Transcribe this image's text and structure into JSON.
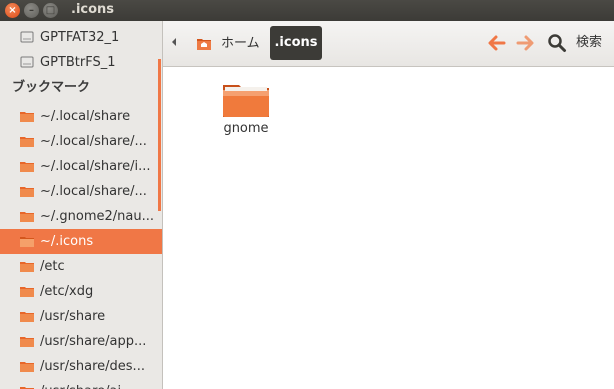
{
  "window": {
    "title": ".icons"
  },
  "sidebar": {
    "devices": [
      "GPTFAT32_1",
      "GPTBtrFS_1"
    ],
    "bookmarks_header": "ブックマーク",
    "bookmarks": [
      "~/.local/share",
      "~/.local/share/...",
      "~/.local/share/i...",
      "~/.local/share/...",
      "~/.gnome2/nau...",
      "~/.icons",
      "/etc",
      "/etc/xdg",
      "/usr/share",
      "/usr/share/app...",
      "/usr/share/des...",
      "/usr/share/ai..."
    ],
    "selected_index": 5
  },
  "toolbar": {
    "crumb_home": "ホーム",
    "crumb_current": ".icons",
    "search_label": "検索"
  },
  "content": {
    "items": [
      {
        "name": "gnome",
        "icon": "folder-icon"
      }
    ]
  },
  "colors": {
    "accent": "#f07746",
    "titlebar": "#3c3b37",
    "folder": "#e8672a"
  }
}
